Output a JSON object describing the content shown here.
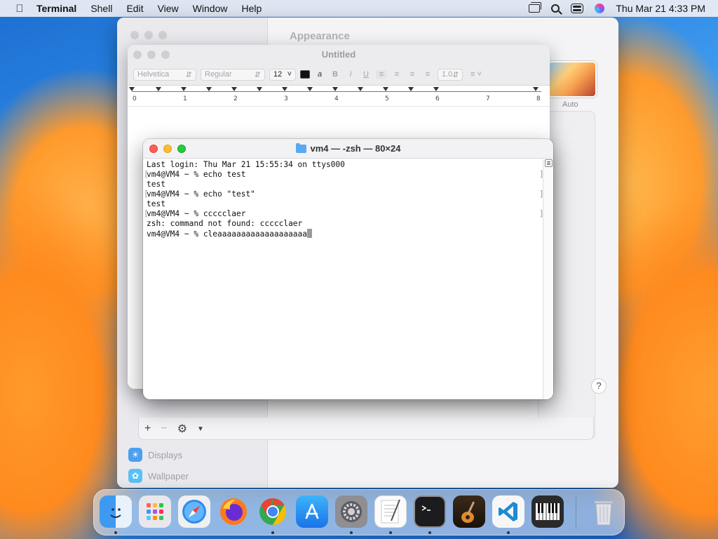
{
  "menubar": {
    "app": "Terminal",
    "items": [
      "Shell",
      "Edit",
      "View",
      "Window",
      "Help"
    ],
    "clock": "Thu Mar 21  4:33 PM"
  },
  "settings": {
    "title": "Appearance",
    "thumb_label": "Auto",
    "sidebar": [
      {
        "label": "Displays",
        "icon": "displays-icon"
      },
      {
        "label": "Wallpaper",
        "icon": "wallpaper-icon"
      }
    ],
    "help": "?"
  },
  "textedit": {
    "title": "Untitled",
    "font": "Helvetica",
    "style": "Regular",
    "size": "12",
    "spacing": "1.0",
    "ruler_numbers": [
      "0",
      "1",
      "2",
      "3",
      "4",
      "5",
      "6",
      "7",
      "8"
    ]
  },
  "terminal": {
    "title": "vm4 — -zsh — 80×24",
    "lines": [
      "Last login: Thu Mar 21 15:55:34 on ttys000",
      "vm4@VM4 ~ % echo test",
      "test",
      "vm4@VM4 ~ % echo \"test\"",
      "test",
      "vm4@VM4 ~ % ccccclaer",
      "zsh: command not found: ccccclaer",
      "vm4@VM4 ~ % cleaaaaaaaaaaaaaaaaaaa"
    ]
  },
  "dock": {
    "apps": [
      "Finder",
      "Launchpad",
      "Safari",
      "Firefox",
      "Chrome",
      "App Store",
      "System Settings",
      "TextEdit",
      "Terminal",
      "GarageBand",
      "Visual Studio Code",
      "Piano"
    ],
    "trash": "Trash"
  },
  "colors": {
    "close": "#ff5f57",
    "minimize": "#febc2e",
    "zoom": "#28c840"
  }
}
